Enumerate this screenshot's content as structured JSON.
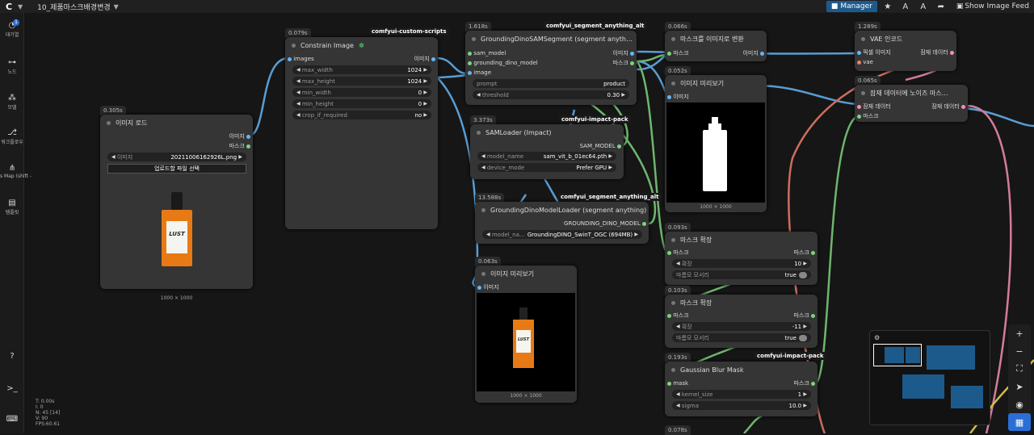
{
  "app": {
    "logo": "C",
    "workflow_title": "10_제품마스크배경변경"
  },
  "topbar": {
    "manager_label": "Manager",
    "feed_label": "Show Image Feed"
  },
  "sidebar": [
    {
      "label": "대기열",
      "icon": "queue-icon",
      "badge": "1"
    },
    {
      "label": "노드",
      "icon": "nodes-icon"
    },
    {
      "label": "모델",
      "icon": "models-icon"
    },
    {
      "label": "워크플로우",
      "icon": "workflow-icon"
    },
    {
      "label": "s Map (shift -",
      "icon": "map-icon"
    },
    {
      "label": "템플릿",
      "icon": "templates-icon"
    }
  ],
  "stats": {
    "t": "T: 0.00s",
    "i": "I: 0",
    "n": "N: 45 [14]",
    "v": "V: 90",
    "fps": "FPS:60.61"
  },
  "nodes": {
    "load_image": {
      "timing": "0.305s",
      "title": "이미지 로드",
      "out_image": "이미지",
      "out_mask": "마스크",
      "image_label": "이미지",
      "image_value": "20211006162926L.png",
      "upload_btn": "업로드할 파일 선택",
      "dim": "1000 × 1000",
      "product_text": "LUST"
    },
    "constrain": {
      "timing": "0.079s",
      "tag": "comfyui-custom-scripts",
      "title": "Constrain Image",
      "in_images": "images",
      "out_image": "이미지",
      "w_max_width": "max_width",
      "v_max_width": "1024",
      "w_max_height": "max_height",
      "v_max_height": "1024",
      "w_min_width": "min_width",
      "v_min_width": "0",
      "w_min_height": "min_height",
      "v_min_height": "0",
      "w_crop": "crop_if_required",
      "v_crop": "no"
    },
    "gdsam": {
      "timing": "1.618s",
      "tag": "comfyui_segment_anything_alt",
      "title": "GroundingDinoSAMSegment (segment anyth…",
      "in_sam": "sam_model",
      "in_gd": "grounding_dino_model",
      "in_image": "image",
      "out_image": "이미지",
      "out_mask": "마스크",
      "w_prompt": "prompt",
      "v_prompt": "product",
      "w_threshold": "threshold",
      "v_threshold": "0.30"
    },
    "samloader": {
      "timing": "3.373s",
      "tag": "comfyui-impact-pack",
      "title": "SAMLoader (Impact)",
      "out": "SAM_MODEL",
      "w_model": "model_name",
      "v_model": "sam_vit_b_01ec64.pth",
      "w_device": "device_mode",
      "v_device": "Prefer GPU"
    },
    "gdloader": {
      "timing": "13.588s",
      "tag": "comfyui_segment_anything_alt",
      "title": "GroundingDinoModelLoader (segment anything)",
      "out": "GROUNDING_DINO_MODEL",
      "w_model": "model_na…",
      "v_model": "GroundingDINO_SwinT_OGC (694MB)"
    },
    "preview2": {
      "timing": "0.063s",
      "title": "이미지 미리보기",
      "in": "이미지",
      "dim": "1000 × 1000",
      "product_text": "LUST"
    },
    "mask2img": {
      "timing": "0.066s",
      "title": "마스크를 이미지로 변환",
      "in": "마스크",
      "out": "이미지"
    },
    "preview1": {
      "timing": "0.052s",
      "title": "이미지 미리보기",
      "in": "이미지",
      "dim": "1000 × 1000"
    },
    "grow1": {
      "timing": "0.093s",
      "title": "마스크 확장",
      "in": "마스크",
      "out": "마스크",
      "w_expand": "확장",
      "v_expand": "10",
      "w_taper": "마름모 모서리",
      "v_taper": "true"
    },
    "grow2": {
      "timing": "0.103s",
      "title": "마스크 확장",
      "in": "마스크",
      "out": "마스크",
      "w_expand": "확장",
      "v_expand": "-11",
      "w_taper": "마름모 모서리",
      "v_taper": "true"
    },
    "blur": {
      "timing": "0.193s",
      "tag": "comfyui-impact-pack",
      "title": "Gaussian Blur Mask",
      "in": "mask",
      "out": "마스크",
      "w_kernel": "kernel_size",
      "v_kernel": "1",
      "w_sigma": "sigma",
      "v_sigma": "10.0"
    },
    "vae": {
      "timing": "1.289s",
      "title": "VAE 인코드",
      "in_pixels": "픽셀 이미지",
      "in_vae": "vae",
      "out": "잠재 데이터"
    },
    "noise": {
      "timing": "0.065s",
      "title": "잠재 데이터에 노이즈 마스…",
      "in_latent": "잠재 데이터",
      "in_mask": "마스크",
      "out": "잠재 데이터"
    },
    "partial": {
      "timing": "0.078s"
    }
  },
  "colors": {
    "accent": "#2a6fd6",
    "wire_blue": "#64b5f6",
    "wire_green": "#7ed37e",
    "wire_pink": "#f48fb1",
    "wire_salmon": "#ef7d6b",
    "wire_yellow": "#f2d94e",
    "tag_green": "#4fd36d"
  }
}
